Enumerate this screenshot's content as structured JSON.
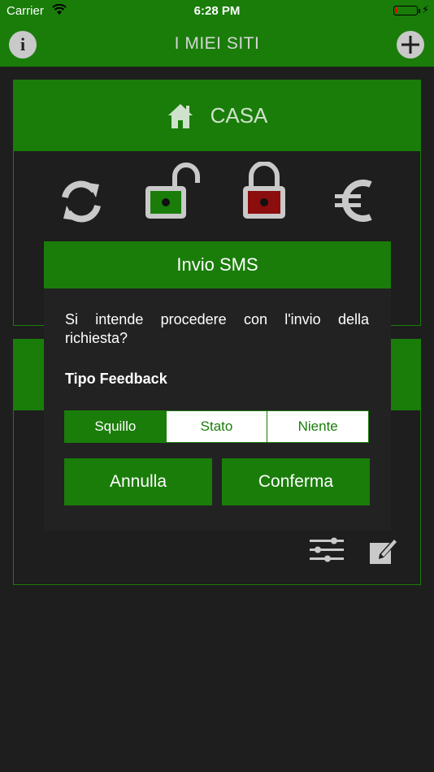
{
  "status_bar": {
    "carrier": "Carrier",
    "time": "6:28 PM",
    "battery_level": 0.1
  },
  "header": {
    "title": "I MIEI SITI",
    "info_icon": "info-icon",
    "add_icon": "plus-icon"
  },
  "sites": [
    {
      "name": "CASA",
      "icon": "home-icon",
      "actions": [
        "refresh-icon",
        "unlock-icon",
        "lock-icon",
        "euro-icon"
      ]
    },
    {
      "name": "",
      "tools": [
        "sliders-icon",
        "edit-icon"
      ]
    }
  ],
  "dialog": {
    "title": "Invio SMS",
    "message": "Si intende procedere con l'invio della richiesta?",
    "feedback_label": "Tipo Feedback",
    "feedback_options": [
      "Squillo",
      "Stato",
      "Niente"
    ],
    "selected_option": "Squillo",
    "cancel_label": "Annulla",
    "confirm_label": "Conferma"
  },
  "colors": {
    "accent": "#1a7d0a",
    "background": "#1e1e1e",
    "dialog_bg": "#222222"
  }
}
